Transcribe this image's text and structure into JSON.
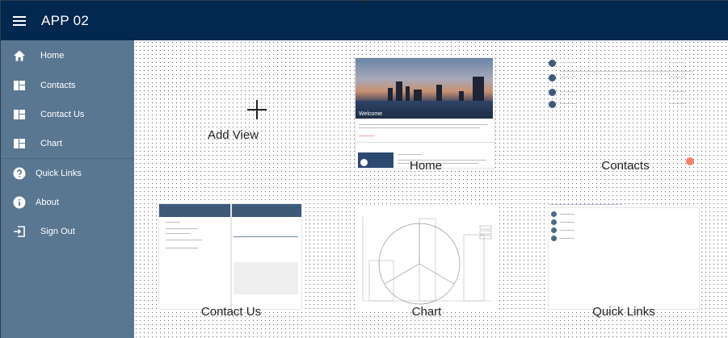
{
  "header": {
    "title": "APP 02"
  },
  "nav": [
    {
      "label": "Home",
      "icon": "home-icon"
    },
    {
      "label": "Contacts",
      "icon": "dashboard-icon"
    },
    {
      "label": "Contact Us",
      "icon": "dashboard-icon"
    },
    {
      "label": "Chart",
      "icon": "dashboard-icon"
    },
    {
      "label": "Quick Links",
      "icon": "help-icon"
    },
    {
      "label": "About",
      "icon": "info-icon"
    },
    {
      "label": "Sign Out",
      "icon": "sign-out-icon"
    }
  ],
  "tiles": {
    "add_view": "Add View",
    "home": "Home",
    "contacts": "Contacts",
    "contact_us": "Contact Us",
    "chart": "Chart",
    "quick_links": "Quick Links"
  },
  "home_preview": {
    "banner_text": "Welcome"
  },
  "colors": {
    "header": "#03284f",
    "sidebar": "#5a7792",
    "accent": "#3e5a78",
    "indicator": "#f0836a"
  }
}
